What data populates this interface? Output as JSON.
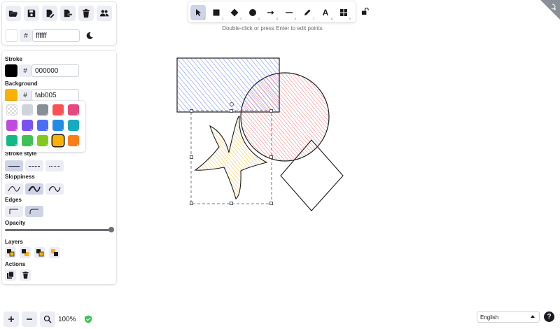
{
  "toolbar": {
    "hint": "Double-click or press Enter to edit points",
    "tools": [
      {
        "name": "selection",
        "key": "1"
      },
      {
        "name": "rectangle",
        "key": "2"
      },
      {
        "name": "diamond",
        "key": "3"
      },
      {
        "name": "ellipse",
        "key": "4"
      },
      {
        "name": "arrow",
        "key": "5"
      },
      {
        "name": "line",
        "key": "6"
      },
      {
        "name": "draw",
        "key": "7"
      },
      {
        "name": "text",
        "key": "8"
      },
      {
        "name": "library",
        "key": "9"
      }
    ],
    "text_tool_glyph": "A"
  },
  "canvas_settings": {
    "background_label_hash": "#",
    "background_hex": "ffffff"
  },
  "properties": {
    "stroke_label": "Stroke",
    "stroke_hex": "000000",
    "background_label": "Background",
    "background_hex": "fab005",
    "hash": "#",
    "stroke_style_label": "Stroke style",
    "sloppiness_label": "Sloppiness",
    "edges_label": "Edges",
    "opacity_label": "Opacity",
    "opacity_value": 1.0,
    "layers_label": "Layers",
    "actions_label": "Actions"
  },
  "palette": [
    {
      "color": "transparent",
      "key": "q"
    },
    {
      "color": "#ced4da",
      "key": "w"
    },
    {
      "color": "#868e96",
      "key": "3"
    },
    {
      "color": "#fa5252",
      "key": "4"
    },
    {
      "color": "#e64980",
      "key": "5"
    },
    {
      "color": "#be4bdb",
      "key": "q"
    },
    {
      "color": "#7950f2",
      "key": "w"
    },
    {
      "color": "#4c6ef5",
      "key": "e"
    },
    {
      "color": "#228be6",
      "key": "r"
    },
    {
      "color": "#15aabf",
      "key": "t"
    },
    {
      "color": "#12b886",
      "key": "a"
    },
    {
      "color": "#40c057",
      "key": "s"
    },
    {
      "color": "#82c91e",
      "key": "d"
    },
    {
      "color": "#fab005",
      "key": "f"
    },
    {
      "color": "#fd7e14",
      "key": "g"
    }
  ],
  "footer": {
    "zoom": "100%",
    "language": "English"
  },
  "colors": {
    "accent": "#ced4e6",
    "stroke": "#000000",
    "background": "#fab005"
  }
}
